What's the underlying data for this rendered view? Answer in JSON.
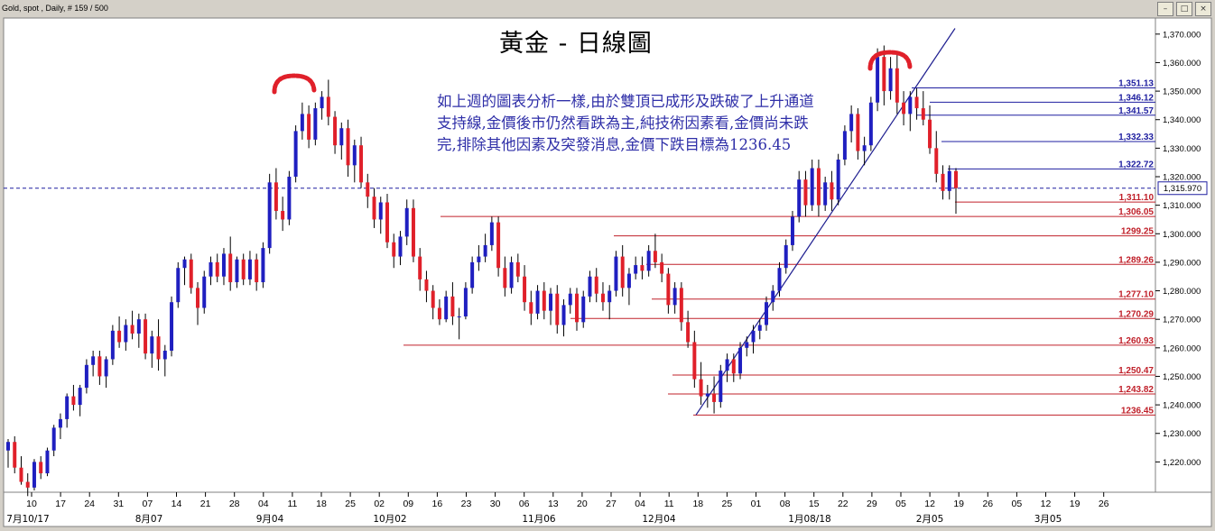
{
  "window": {
    "header": "Gold, spot , Daily, # 159 / 500",
    "controls": [
      "minimize",
      "maximize",
      "close"
    ]
  },
  "title": "黃金 - 日線圖",
  "annotation": "如上週的圖表分析一樣,由於雙頂已成形及跌破了上升通道支持線,金價後市仍然看跌為主,純技術因素看,金價尚未跌完,排除其他因素及突發消息,金價下跌目標為1236.45",
  "colors": {
    "up": "#1f1fc0",
    "down": "#e0202a",
    "hline": "#c0202a",
    "upper_line": "#1f1fa0",
    "trend": "#1f1f90",
    "grid_bg": "#ffffff"
  },
  "chart_data": {
    "type": "candlestick",
    "instrument": "Gold, spot",
    "timeframe": "Daily",
    "ylim": [
      1210,
      1375
    ],
    "y_ticks": [
      1220,
      1230,
      1240,
      1250,
      1260,
      1270,
      1280,
      1290,
      1300,
      1310,
      1320,
      1330,
      1340,
      1350,
      1360,
      1370
    ],
    "x_day_labels": [
      "10",
      "17",
      "24",
      "31",
      "07",
      "14",
      "21",
      "28",
      "04",
      "11",
      "18",
      "25",
      "02",
      "09",
      "16",
      "23",
      "30",
      "06",
      "13",
      "20",
      "27",
      "04",
      "11",
      "18",
      "25",
      "01",
      "08",
      "15",
      "22",
      "29",
      "05",
      "12",
      "19",
      "26",
      "05",
      "12",
      "19",
      "26"
    ],
    "x_month_labels": [
      "7月10/17",
      "8月07",
      "9月04",
      "10月02",
      "11月06",
      "12月04",
      "1月08/18",
      "2月05",
      "3月05"
    ],
    "current_price": "1,315.970",
    "levels": [
      {
        "value": 1351.13,
        "label": "1,351.13",
        "color": "blue"
      },
      {
        "value": 1346.12,
        "label": "1,346.12",
        "color": "blue"
      },
      {
        "value": 1341.57,
        "label": "1,341.57",
        "color": "blue"
      },
      {
        "value": 1332.33,
        "label": "1,332.33",
        "color": "blue"
      },
      {
        "value": 1322.72,
        "label": "1,322.72",
        "color": "blue"
      },
      {
        "value": 1311.1,
        "label": "1,311.10",
        "color": "red"
      },
      {
        "value": 1306.05,
        "label": "1,306.05",
        "color": "red"
      },
      {
        "value": 1299.25,
        "label": "1299.25",
        "color": "red"
      },
      {
        "value": 1289.26,
        "label": "1,289.26",
        "color": "red"
      },
      {
        "value": 1277.1,
        "label": "1,277.10",
        "color": "red"
      },
      {
        "value": 1270.29,
        "label": "1,270.29",
        "color": "red"
      },
      {
        "value": 1260.93,
        "label": "1,260.93",
        "color": "red"
      },
      {
        "value": 1250.47,
        "label": "1,250.47",
        "color": "red"
      },
      {
        "value": 1243.82,
        "label": "1,243.82",
        "color": "red"
      },
      {
        "value": 1236.45,
        "label": "1236.45",
        "color": "red"
      }
    ],
    "candles": [
      [
        1224,
        1228,
        1218,
        1227
      ],
      [
        1227,
        1229,
        1216,
        1218
      ],
      [
        1218,
        1222,
        1212,
        1213
      ],
      [
        1213,
        1216,
        1208,
        1211
      ],
      [
        1211,
        1221,
        1210,
        1220
      ],
      [
        1220,
        1222,
        1214,
        1216
      ],
      [
        1216,
        1225,
        1215,
        1224
      ],
      [
        1224,
        1233,
        1222,
        1232
      ],
      [
        1232,
        1237,
        1228,
        1235
      ],
      [
        1235,
        1244,
        1232,
        1243
      ],
      [
        1243,
        1247,
        1238,
        1240
      ],
      [
        1240,
        1247,
        1236,
        1246
      ],
      [
        1246,
        1256,
        1244,
        1254
      ],
      [
        1254,
        1259,
        1250,
        1257
      ],
      [
        1257,
        1259,
        1247,
        1250
      ],
      [
        1250,
        1257,
        1246,
        1256
      ],
      [
        1256,
        1268,
        1254,
        1266
      ],
      [
        1266,
        1271,
        1260,
        1262
      ],
      [
        1262,
        1270,
        1259,
        1268
      ],
      [
        1268,
        1273,
        1263,
        1265
      ],
      [
        1265,
        1272,
        1260,
        1270
      ],
      [
        1270,
        1272,
        1256,
        1258
      ],
      [
        1258,
        1266,
        1253,
        1264
      ],
      [
        1264,
        1270,
        1252,
        1256
      ],
      [
        1256,
        1261,
        1250,
        1259
      ],
      [
        1259,
        1278,
        1257,
        1276
      ],
      [
        1276,
        1290,
        1274,
        1288
      ],
      [
        1288,
        1292,
        1282,
        1291
      ],
      [
        1291,
        1293,
        1279,
        1281
      ],
      [
        1281,
        1283,
        1268,
        1274
      ],
      [
        1274,
        1287,
        1272,
        1285
      ],
      [
        1285,
        1292,
        1282,
        1290
      ],
      [
        1290,
        1293,
        1283,
        1285
      ],
      [
        1285,
        1295,
        1282,
        1293
      ],
      [
        1293,
        1299,
        1280,
        1283
      ],
      [
        1283,
        1292,
        1281,
        1291
      ],
      [
        1291,
        1293,
        1282,
        1284
      ],
      [
        1284,
        1294,
        1282,
        1291
      ],
      [
        1291,
        1293,
        1280,
        1283
      ],
      [
        1283,
        1297,
        1281,
        1295
      ],
      [
        1295,
        1321,
        1293,
        1318
      ],
      [
        1318,
        1323,
        1305,
        1308
      ],
      [
        1308,
        1313,
        1301,
        1305
      ],
      [
        1305,
        1322,
        1303,
        1320
      ],
      [
        1320,
        1338,
        1318,
        1336
      ],
      [
        1336,
        1346,
        1333,
        1342
      ],
      [
        1342,
        1345,
        1330,
        1333
      ],
      [
        1333,
        1346,
        1331,
        1344
      ],
      [
        1344,
        1350,
        1340,
        1348
      ],
      [
        1348,
        1354,
        1338,
        1341
      ],
      [
        1341,
        1343,
        1328,
        1331
      ],
      [
        1331,
        1339,
        1326,
        1337
      ],
      [
        1337,
        1340,
        1320,
        1324
      ],
      [
        1324,
        1333,
        1318,
        1331
      ],
      [
        1331,
        1334,
        1316,
        1318
      ],
      [
        1318,
        1321,
        1309,
        1313
      ],
      [
        1313,
        1316,
        1302,
        1305
      ],
      [
        1305,
        1313,
        1300,
        1311
      ],
      [
        1311,
        1314,
        1295,
        1297
      ],
      [
        1297,
        1300,
        1288,
        1292
      ],
      [
        1292,
        1301,
        1289,
        1299
      ],
      [
        1299,
        1312,
        1296,
        1309
      ],
      [
        1309,
        1312,
        1290,
        1292
      ],
      [
        1292,
        1295,
        1280,
        1284
      ],
      [
        1284,
        1287,
        1276,
        1280
      ],
      [
        1280,
        1282,
        1270,
        1274
      ],
      [
        1274,
        1277,
        1268,
        1270
      ],
      [
        1270,
        1280,
        1269,
        1278
      ],
      [
        1278,
        1283,
        1268,
        1271
      ],
      [
        1271,
        1274,
        1263,
        1271
      ],
      [
        1271,
        1283,
        1270,
        1281
      ],
      [
        1281,
        1292,
        1279,
        1290
      ],
      [
        1290,
        1296,
        1287,
        1292
      ],
      [
        1292,
        1300,
        1290,
        1296
      ],
      [
        1296,
        1306,
        1294,
        1304
      ],
      [
        1304,
        1306,
        1285,
        1288
      ],
      [
        1288,
        1292,
        1278,
        1281
      ],
      [
        1281,
        1292,
        1279,
        1290
      ],
      [
        1290,
        1293,
        1283,
        1285
      ],
      [
        1285,
        1289,
        1273,
        1276
      ],
      [
        1276,
        1280,
        1268,
        1272
      ],
      [
        1272,
        1282,
        1270,
        1280
      ],
      [
        1280,
        1283,
        1270,
        1273
      ],
      [
        1273,
        1281,
        1268,
        1279
      ],
      [
        1279,
        1282,
        1265,
        1268
      ],
      [
        1268,
        1277,
        1264,
        1275
      ],
      [
        1275,
        1281,
        1272,
        1279
      ],
      [
        1279,
        1281,
        1266,
        1269
      ],
      [
        1269,
        1280,
        1267,
        1278
      ],
      [
        1278,
        1287,
        1276,
        1285
      ],
      [
        1285,
        1288,
        1276,
        1279
      ],
      [
        1279,
        1283,
        1273,
        1276
      ],
      [
        1276,
        1282,
        1270,
        1280
      ],
      [
        1280,
        1294,
        1278,
        1292
      ],
      [
        1292,
        1296,
        1278,
        1281
      ],
      [
        1281,
        1288,
        1275,
        1286
      ],
      [
        1286,
        1292,
        1284,
        1289
      ],
      [
        1289,
        1292,
        1284,
        1287
      ],
      [
        1287,
        1296,
        1285,
        1294
      ],
      [
        1294,
        1300,
        1288,
        1290
      ],
      [
        1290,
        1293,
        1283,
        1286
      ],
      [
        1286,
        1288,
        1272,
        1275
      ],
      [
        1275,
        1283,
        1272,
        1281
      ],
      [
        1281,
        1283,
        1266,
        1269
      ],
      [
        1269,
        1273,
        1260,
        1262
      ],
      [
        1262,
        1266,
        1246,
        1249
      ],
      [
        1249,
        1255,
        1240,
        1243
      ],
      [
        1243,
        1247,
        1239,
        1244
      ],
      [
        1244,
        1250,
        1237,
        1241
      ],
      [
        1241,
        1254,
        1239,
        1252
      ],
      [
        1252,
        1258,
        1248,
        1256
      ],
      [
        1256,
        1258,
        1248,
        1251
      ],
      [
        1251,
        1262,
        1249,
        1260
      ],
      [
        1260,
        1264,
        1257,
        1262
      ],
      [
        1262,
        1268,
        1258,
        1266
      ],
      [
        1266,
        1270,
        1263,
        1268
      ],
      [
        1268,
        1278,
        1266,
        1276
      ],
      [
        1276,
        1282,
        1273,
        1280
      ],
      [
        1280,
        1290,
        1278,
        1288
      ],
      [
        1288,
        1298,
        1286,
        1296
      ],
      [
        1296,
        1308,
        1294,
        1306
      ],
      [
        1306,
        1322,
        1304,
        1319
      ],
      [
        1319,
        1322,
        1306,
        1310
      ],
      [
        1310,
        1326,
        1308,
        1323
      ],
      [
        1323,
        1326,
        1306,
        1310
      ],
      [
        1310,
        1320,
        1308,
        1318
      ],
      [
        1318,
        1322,
        1308,
        1312
      ],
      [
        1312,
        1328,
        1310,
        1326
      ],
      [
        1326,
        1338,
        1324,
        1336
      ],
      [
        1336,
        1345,
        1332,
        1342
      ],
      [
        1342,
        1344,
        1326,
        1329
      ],
      [
        1329,
        1334,
        1324,
        1331
      ],
      [
        1331,
        1348,
        1329,
        1346
      ],
      [
        1346,
        1365,
        1343,
        1362
      ],
      [
        1362,
        1366,
        1345,
        1350
      ],
      [
        1350,
        1362,
        1347,
        1358
      ],
      [
        1358,
        1363,
        1342,
        1346
      ],
      [
        1346,
        1350,
        1338,
        1342
      ],
      [
        1342,
        1350,
        1336,
        1348
      ],
      [
        1348,
        1351,
        1340,
        1344
      ],
      [
        1344,
        1350,
        1338,
        1340
      ],
      [
        1340,
        1345,
        1328,
        1330
      ],
      [
        1330,
        1336,
        1318,
        1321
      ],
      [
        1321,
        1324,
        1312,
        1315
      ],
      [
        1315,
        1324,
        1312,
        1322
      ],
      [
        1322,
        1323,
        1307,
        1316
      ]
    ]
  }
}
